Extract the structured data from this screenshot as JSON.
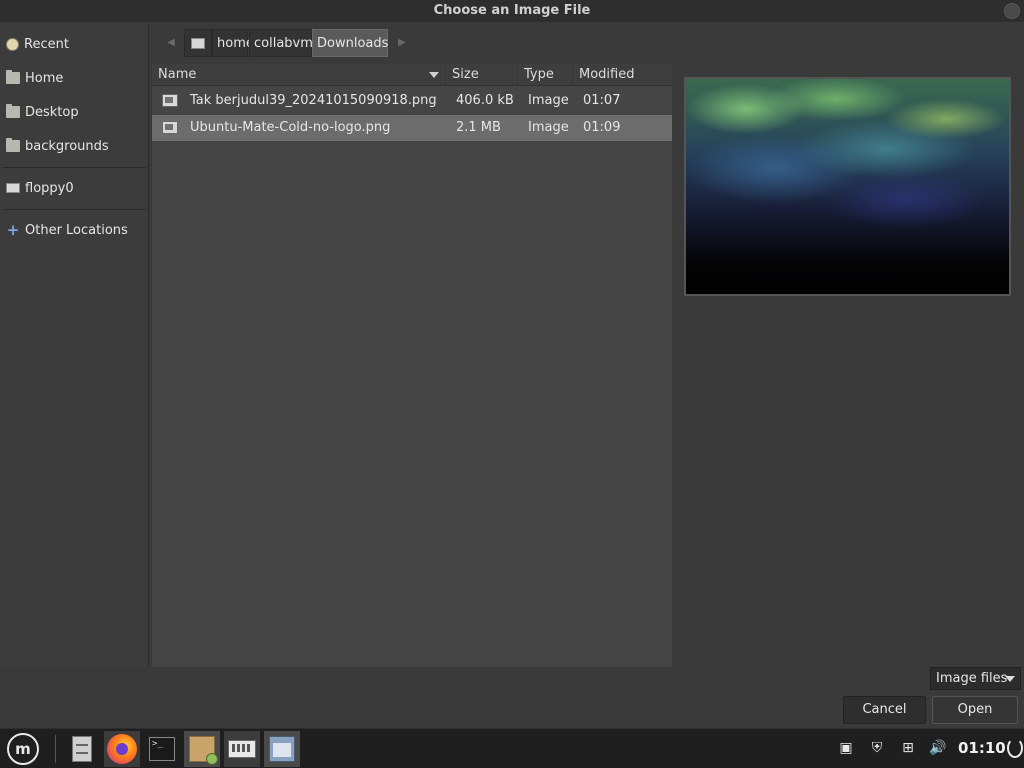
{
  "window": {
    "title": "Choose an Image File"
  },
  "sidebar": {
    "items": [
      {
        "label": "Recent",
        "icon": "recent-icon"
      },
      {
        "label": "Home",
        "icon": "home-folder-icon"
      },
      {
        "label": "Desktop",
        "icon": "desktop-folder-icon"
      },
      {
        "label": "backgrounds",
        "icon": "folder-icon"
      },
      {
        "label": "floppy0",
        "icon": "drive-icon"
      },
      {
        "label": "Other Locations",
        "icon": "plus-icon"
      }
    ]
  },
  "breadcrumb": {
    "items": [
      "home",
      "collabvm",
      "Downloads"
    ],
    "active": "Downloads"
  },
  "filelist": {
    "columns": [
      "Name",
      "Size",
      "Type",
      "Modified"
    ],
    "rows": [
      {
        "name": "Tak berjudul39_20241015090918.png",
        "size": "406.0 kB",
        "type": "Image",
        "modified": "01:07"
      },
      {
        "name": "Ubuntu-Mate-Cold-no-logo.png",
        "size": "2.1 MB",
        "type": "Image",
        "modified": "01:09",
        "selected": true
      }
    ]
  },
  "footer": {
    "filter_label": "Image files",
    "cancel_label": "Cancel",
    "open_label": "Open"
  },
  "taskbar": {
    "apps": [
      "files-icon",
      "firefox-icon",
      "terminal-icon",
      "package-icon",
      "keyboard-icon",
      "window-icon"
    ],
    "clock": "01:10"
  },
  "colors": {
    "selected_row": "#6c6c6c",
    "panel": "#454545",
    "taskbar": "#1f1f1f"
  }
}
